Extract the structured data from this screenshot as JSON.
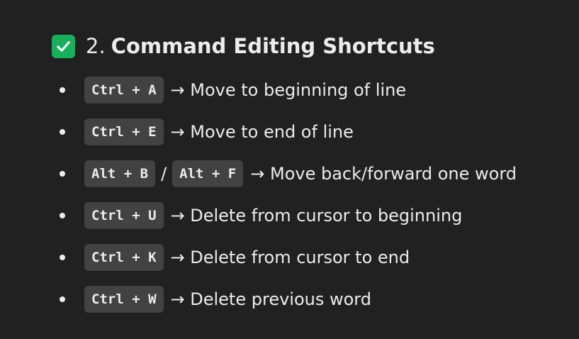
{
  "section": {
    "number": "2.",
    "title": "Command Editing Shortcuts",
    "icon": "check-mark-button-icon",
    "icon_color": "#17b15b"
  },
  "shortcuts": [
    {
      "keys": [
        "Ctrl + A"
      ],
      "description": "→ Move to beginning of line"
    },
    {
      "keys": [
        "Ctrl + E"
      ],
      "description": "→ Move to end of line"
    },
    {
      "keys": [
        "Alt + B",
        "Alt + F"
      ],
      "separator": "/",
      "description": "→ Move back/forward one word"
    },
    {
      "keys": [
        "Ctrl + U"
      ],
      "description": "→ Delete from cursor to beginning"
    },
    {
      "keys": [
        "Ctrl + K"
      ],
      "description": "→ Delete from cursor to end"
    },
    {
      "keys": [
        "Ctrl + W"
      ],
      "description": "→ Delete previous word"
    }
  ]
}
